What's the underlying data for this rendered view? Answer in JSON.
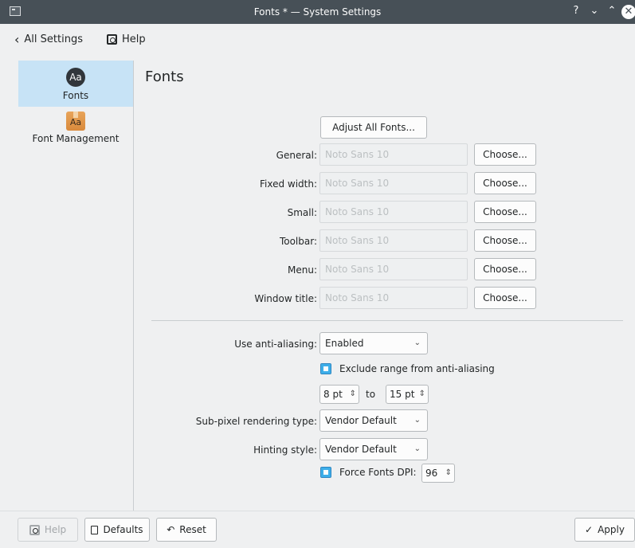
{
  "window": {
    "title": "Fonts * — System Settings",
    "controls": {
      "help": "?",
      "minimize": "⌄",
      "maximize": "⌃",
      "close": "✕"
    }
  },
  "nav": {
    "back_label": "All Settings",
    "help_label": "Help"
  },
  "sidebar": {
    "items": [
      {
        "label": "Fonts",
        "icon_text": "Aa",
        "active": true
      },
      {
        "label": "Font Management",
        "icon_text": "Aa",
        "active": false
      }
    ]
  },
  "page": {
    "title": "Fonts",
    "adjust_all_label": "Adjust All Fonts...",
    "choose_label": "Choose...",
    "font_rows": [
      {
        "label": "General:",
        "value": "Noto Sans 10"
      },
      {
        "label": "Fixed width:",
        "value": "Noto Sans 10"
      },
      {
        "label": "Small:",
        "value": "Noto Sans 10"
      },
      {
        "label": "Toolbar:",
        "value": "Noto Sans 10"
      },
      {
        "label": "Menu:",
        "value": "Noto Sans 10"
      },
      {
        "label": "Window title:",
        "value": "Noto Sans 10"
      }
    ],
    "anti_aliasing": {
      "label": "Use anti-aliasing:",
      "value": "Enabled"
    },
    "exclude_range": {
      "label": "Exclude range from anti-aliasing",
      "checked": true,
      "from": "8 pt",
      "to_label": "to",
      "to": "15 pt"
    },
    "subpixel": {
      "label": "Sub-pixel rendering type:",
      "value": "Vendor Default"
    },
    "hinting": {
      "label": "Hinting style:",
      "value": "Vendor Default"
    },
    "force_dpi": {
      "label": "Force Fonts DPI:",
      "checked": true,
      "value": "96"
    }
  },
  "footer": {
    "help_label": "Help",
    "defaults_label": "Defaults",
    "reset_label": "Reset",
    "apply_label": "Apply"
  },
  "colors": {
    "accent": "#3daee9",
    "titlebar": "#475057",
    "selection": "#c7e3f6"
  }
}
